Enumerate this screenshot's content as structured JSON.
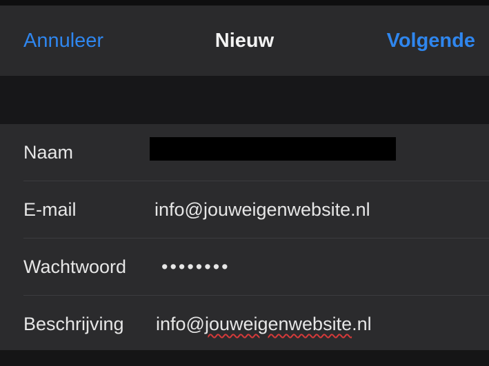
{
  "navbar": {
    "cancel_label": "Annuleer",
    "title": "Nieuw",
    "next_label": "Volgende"
  },
  "form": {
    "name": {
      "label": "Naam",
      "value_redacted": true
    },
    "email": {
      "label": "E-mail",
      "value": "info@jouweigenwebsite.nl"
    },
    "password": {
      "label": "Wachtwoord",
      "value": "••••••••"
    },
    "description": {
      "label": "Beschrijving",
      "value": "info@",
      "value_misspelled": "jouweigenwebsite",
      "value_suffix": ".nl"
    }
  },
  "colors": {
    "accent": "#2f86ee",
    "background": "#1c1c1e",
    "cell": "#2b2b2d",
    "text": "#e6e6e6"
  }
}
